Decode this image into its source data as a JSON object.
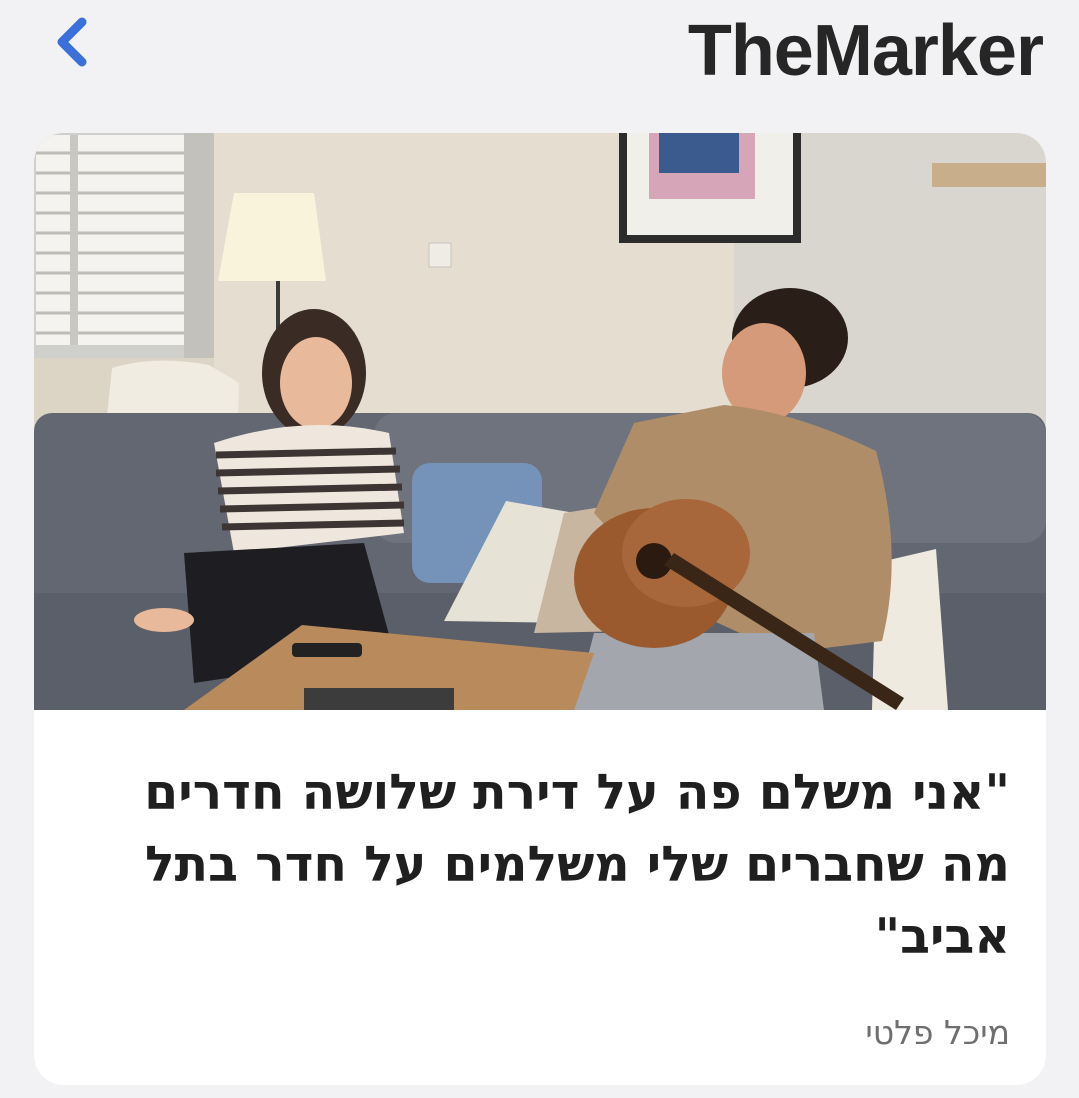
{
  "header": {
    "back_icon": "chevron-left-icon",
    "brand": "TheMarker",
    "accent_color": "#3b6fd9"
  },
  "article": {
    "image_description": "photo",
    "headline": "\"אני משלם פה על דירת שלושה חדרים מה שחברים שלי משלמים על חדר בתל אביב\"",
    "author": "מיכל פלטי"
  }
}
